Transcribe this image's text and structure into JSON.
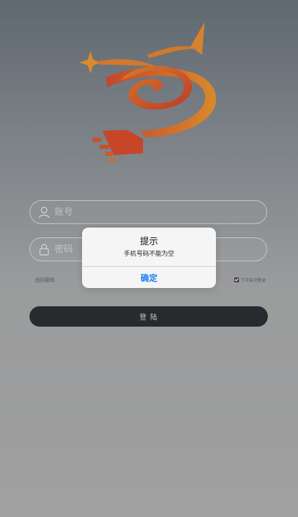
{
  "form": {
    "account_placeholder": "账号",
    "password_placeholder": "密码",
    "forgot_label": "找回密码",
    "remember_label": "下次自动登录",
    "login_label": "登 陆"
  },
  "alert": {
    "title": "提示",
    "message": "手机号码不能为空",
    "confirm_label": "确定"
  },
  "icons": {
    "logo": "app-logo",
    "account": "user-icon",
    "password": "lock-icon",
    "remember": "checkbox-checked-icon"
  },
  "colors": {
    "logo_orange": "#e08a2a",
    "logo_red": "#c0392b",
    "button_dark": "#272b2f",
    "alert_link": "#1a7ef2"
  }
}
